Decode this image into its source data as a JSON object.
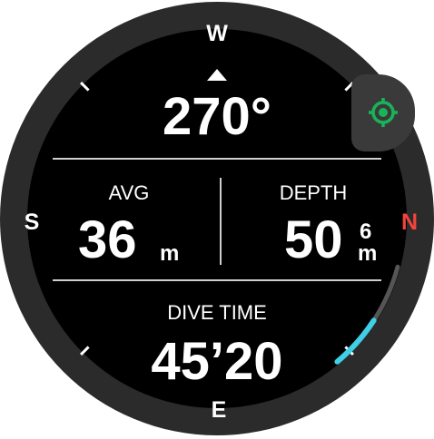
{
  "compass": {
    "north": "N",
    "south": "S",
    "east": "E",
    "west": "W",
    "heading": "270°"
  },
  "avg_depth": {
    "label": "AVG",
    "value": "36",
    "unit": "m"
  },
  "depth": {
    "label": "DEPTH",
    "value": "50",
    "decimal": "6",
    "unit": "m"
  },
  "dive_time": {
    "label": "DIVE TIME",
    "value": "45’20"
  },
  "progress": {
    "fraction": 0.22
  },
  "colors": {
    "bezel": "#2b2b2b",
    "face": "#000000",
    "north": "#f2453d",
    "target_icon": "#19b35a",
    "progress": "#3fd0e6"
  },
  "icons": {
    "target_button": "crosshair-target-icon",
    "heading_marker": "triangle-up-icon"
  }
}
